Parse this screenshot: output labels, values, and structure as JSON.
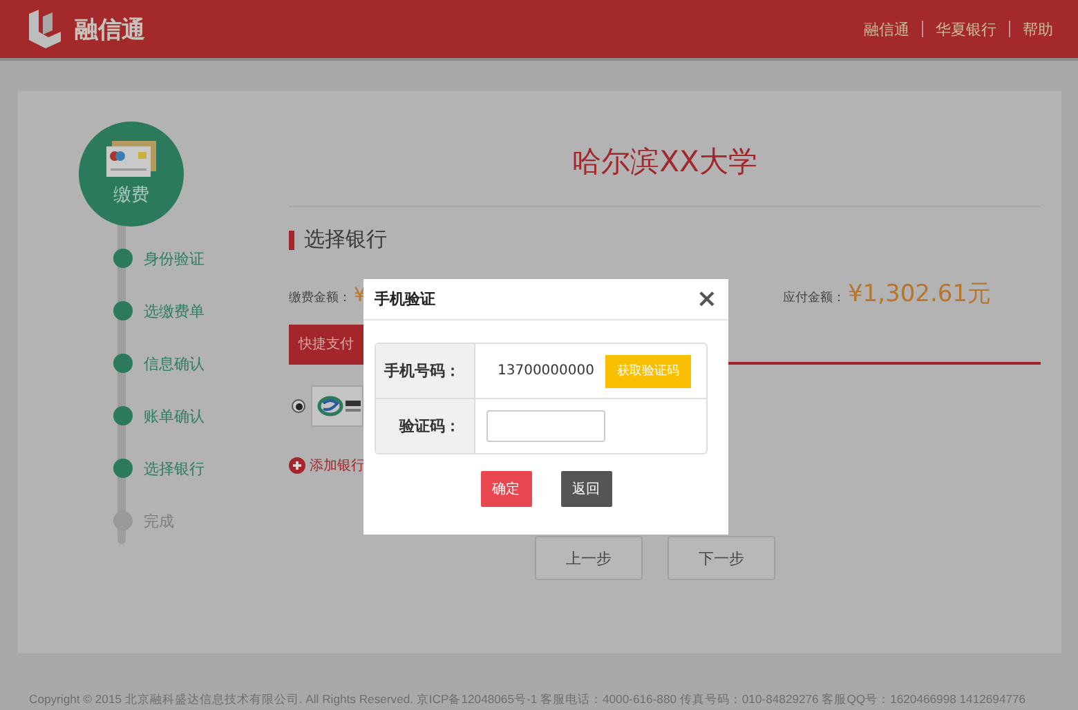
{
  "header": {
    "logo_text": "融信通",
    "nav_links": [
      "融信通",
      "华夏银行",
      "帮助"
    ]
  },
  "sidebar": {
    "badge_label": "缴费",
    "steps": [
      {
        "label": "身份验证",
        "done": true
      },
      {
        "label": "选缴费单",
        "done": true
      },
      {
        "label": "信息确认",
        "done": true
      },
      {
        "label": "账单确认",
        "done": true
      },
      {
        "label": "选择银行",
        "done": true
      },
      {
        "label": "完成",
        "done": false
      }
    ]
  },
  "main": {
    "school_name": "哈尔滨XX大学",
    "section_title": "选择银行",
    "fee_label": "缴费金额：",
    "fee_amount": "¥",
    "payable_label": "应付金额：",
    "payable_amount": "¥1,302.61元",
    "tabs": [
      {
        "label": "快捷支付",
        "selected": true
      }
    ],
    "banks": [
      {
        "selected": true
      }
    ],
    "add_bank": "添加银行",
    "buttons": [
      "上一步",
      "下一步"
    ]
  },
  "modal": {
    "title": "手机验证",
    "close": "×",
    "phone_label": "手机号码：",
    "phone_value": "13700000000",
    "get_code_button": "获取验证码",
    "code_label": "验证码：",
    "buttons": [
      {
        "label": "确定",
        "kind": "primary"
      },
      {
        "label": "返回",
        "kind": "secondary"
      }
    ]
  },
  "footer": {
    "text": "Copyright © 2015 北京融科盛达信息技术有限公司. All Rights Reserved. 京ICP备12048065号-1 客服电话：4000-616-880 传真号码：010-84829276 客服QQ号：1620466998 1412694776"
  }
}
